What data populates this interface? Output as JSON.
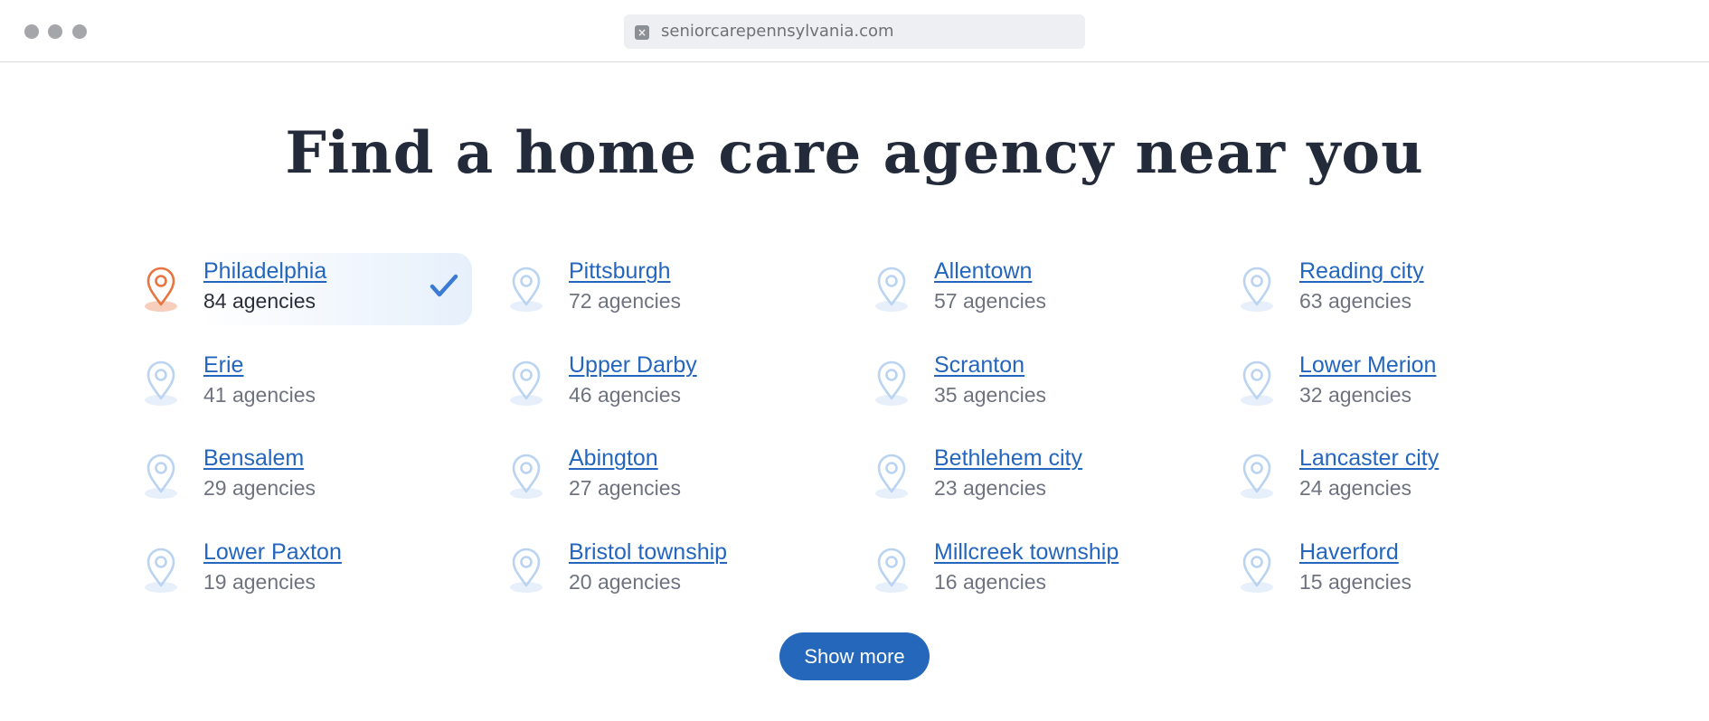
{
  "browser": {
    "url": "seniorcarepennsylvania.com",
    "site_icon": "close-x-icon"
  },
  "heading": "Find a home care agency near you",
  "colors": {
    "accent": "#2466be",
    "pin_default": "#b9d3f1",
    "pin_selected": "#e8743f",
    "check": "#3b7bd4",
    "button": "#2568bb"
  },
  "cities": [
    {
      "name": "Philadelphia",
      "count": "84 agencies",
      "selected": true
    },
    {
      "name": "Pittsburgh",
      "count": "72 agencies"
    },
    {
      "name": "Allentown",
      "count": "57 agencies"
    },
    {
      "name": "Reading city",
      "count": "63 agencies"
    },
    {
      "name": "Erie",
      "count": "41 agencies"
    },
    {
      "name": "Upper Darby",
      "count": "46 agencies"
    },
    {
      "name": "Scranton",
      "count": "35 agencies"
    },
    {
      "name": "Lower Merion",
      "count": "32 agencies"
    },
    {
      "name": "Bensalem",
      "count": "29 agencies"
    },
    {
      "name": "Abington",
      "count": "27 agencies"
    },
    {
      "name": "Bethlehem city",
      "count": "23 agencies"
    },
    {
      "name": "Lancaster city",
      "count": "24 agencies"
    },
    {
      "name": "Lower Paxton",
      "count": "19 agencies"
    },
    {
      "name": "Bristol township",
      "count": "20 agencies"
    },
    {
      "name": "Millcreek township",
      "count": "16 agencies"
    },
    {
      "name": "Haverford",
      "count": "15 agencies"
    }
  ],
  "show_more_label": "Show more"
}
